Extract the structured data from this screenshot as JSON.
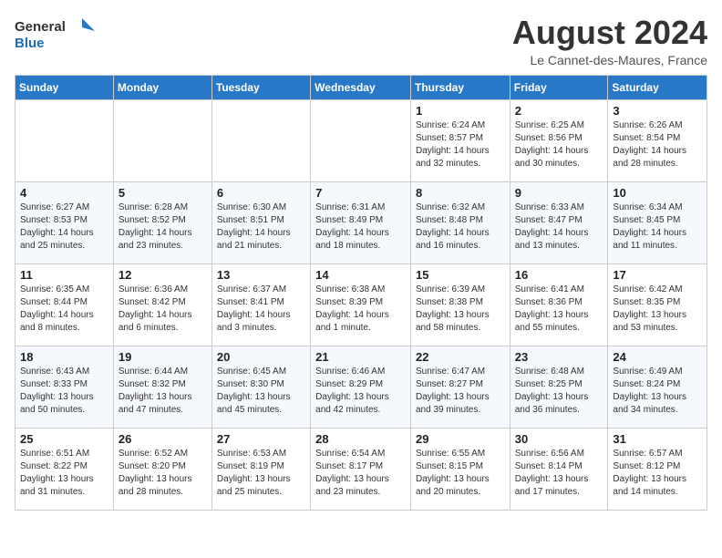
{
  "logo": {
    "line1": "General",
    "line2": "Blue"
  },
  "title": "August 2024",
  "location": "Le Cannet-des-Maures, France",
  "weekdays": [
    "Sunday",
    "Monday",
    "Tuesday",
    "Wednesday",
    "Thursday",
    "Friday",
    "Saturday"
  ],
  "weeks": [
    [
      {
        "day": "",
        "info": ""
      },
      {
        "day": "",
        "info": ""
      },
      {
        "day": "",
        "info": ""
      },
      {
        "day": "",
        "info": ""
      },
      {
        "day": "1",
        "info": "Sunrise: 6:24 AM\nSunset: 8:57 PM\nDaylight: 14 hours\nand 32 minutes."
      },
      {
        "day": "2",
        "info": "Sunrise: 6:25 AM\nSunset: 8:56 PM\nDaylight: 14 hours\nand 30 minutes."
      },
      {
        "day": "3",
        "info": "Sunrise: 6:26 AM\nSunset: 8:54 PM\nDaylight: 14 hours\nand 28 minutes."
      }
    ],
    [
      {
        "day": "4",
        "info": "Sunrise: 6:27 AM\nSunset: 8:53 PM\nDaylight: 14 hours\nand 25 minutes."
      },
      {
        "day": "5",
        "info": "Sunrise: 6:28 AM\nSunset: 8:52 PM\nDaylight: 14 hours\nand 23 minutes."
      },
      {
        "day": "6",
        "info": "Sunrise: 6:30 AM\nSunset: 8:51 PM\nDaylight: 14 hours\nand 21 minutes."
      },
      {
        "day": "7",
        "info": "Sunrise: 6:31 AM\nSunset: 8:49 PM\nDaylight: 14 hours\nand 18 minutes."
      },
      {
        "day": "8",
        "info": "Sunrise: 6:32 AM\nSunset: 8:48 PM\nDaylight: 14 hours\nand 16 minutes."
      },
      {
        "day": "9",
        "info": "Sunrise: 6:33 AM\nSunset: 8:47 PM\nDaylight: 14 hours\nand 13 minutes."
      },
      {
        "day": "10",
        "info": "Sunrise: 6:34 AM\nSunset: 8:45 PM\nDaylight: 14 hours\nand 11 minutes."
      }
    ],
    [
      {
        "day": "11",
        "info": "Sunrise: 6:35 AM\nSunset: 8:44 PM\nDaylight: 14 hours\nand 8 minutes."
      },
      {
        "day": "12",
        "info": "Sunrise: 6:36 AM\nSunset: 8:42 PM\nDaylight: 14 hours\nand 6 minutes."
      },
      {
        "day": "13",
        "info": "Sunrise: 6:37 AM\nSunset: 8:41 PM\nDaylight: 14 hours\nand 3 minutes."
      },
      {
        "day": "14",
        "info": "Sunrise: 6:38 AM\nSunset: 8:39 PM\nDaylight: 14 hours\nand 1 minute."
      },
      {
        "day": "15",
        "info": "Sunrise: 6:39 AM\nSunset: 8:38 PM\nDaylight: 13 hours\nand 58 minutes."
      },
      {
        "day": "16",
        "info": "Sunrise: 6:41 AM\nSunset: 8:36 PM\nDaylight: 13 hours\nand 55 minutes."
      },
      {
        "day": "17",
        "info": "Sunrise: 6:42 AM\nSunset: 8:35 PM\nDaylight: 13 hours\nand 53 minutes."
      }
    ],
    [
      {
        "day": "18",
        "info": "Sunrise: 6:43 AM\nSunset: 8:33 PM\nDaylight: 13 hours\nand 50 minutes."
      },
      {
        "day": "19",
        "info": "Sunrise: 6:44 AM\nSunset: 8:32 PM\nDaylight: 13 hours\nand 47 minutes."
      },
      {
        "day": "20",
        "info": "Sunrise: 6:45 AM\nSunset: 8:30 PM\nDaylight: 13 hours\nand 45 minutes."
      },
      {
        "day": "21",
        "info": "Sunrise: 6:46 AM\nSunset: 8:29 PM\nDaylight: 13 hours\nand 42 minutes."
      },
      {
        "day": "22",
        "info": "Sunrise: 6:47 AM\nSunset: 8:27 PM\nDaylight: 13 hours\nand 39 minutes."
      },
      {
        "day": "23",
        "info": "Sunrise: 6:48 AM\nSunset: 8:25 PM\nDaylight: 13 hours\nand 36 minutes."
      },
      {
        "day": "24",
        "info": "Sunrise: 6:49 AM\nSunset: 8:24 PM\nDaylight: 13 hours\nand 34 minutes."
      }
    ],
    [
      {
        "day": "25",
        "info": "Sunrise: 6:51 AM\nSunset: 8:22 PM\nDaylight: 13 hours\nand 31 minutes."
      },
      {
        "day": "26",
        "info": "Sunrise: 6:52 AM\nSunset: 8:20 PM\nDaylight: 13 hours\nand 28 minutes."
      },
      {
        "day": "27",
        "info": "Sunrise: 6:53 AM\nSunset: 8:19 PM\nDaylight: 13 hours\nand 25 minutes."
      },
      {
        "day": "28",
        "info": "Sunrise: 6:54 AM\nSunset: 8:17 PM\nDaylight: 13 hours\nand 23 minutes."
      },
      {
        "day": "29",
        "info": "Sunrise: 6:55 AM\nSunset: 8:15 PM\nDaylight: 13 hours\nand 20 minutes."
      },
      {
        "day": "30",
        "info": "Sunrise: 6:56 AM\nSunset: 8:14 PM\nDaylight: 13 hours\nand 17 minutes."
      },
      {
        "day": "31",
        "info": "Sunrise: 6:57 AM\nSunset: 8:12 PM\nDaylight: 13 hours\nand 14 minutes."
      }
    ]
  ]
}
